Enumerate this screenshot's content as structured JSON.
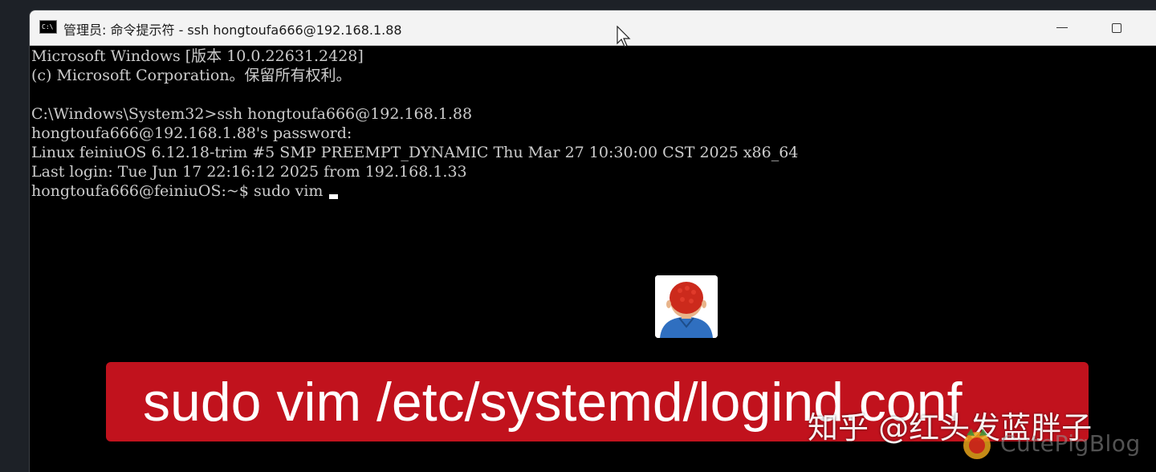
{
  "window": {
    "title": "管理员: 命令提示符 - ssh  hongtoufa666@192.168.1.88",
    "app_icon_label": "C:\\"
  },
  "console": {
    "lines": [
      "Microsoft Windows [版本 10.0.22631.2428]",
      "(c) Microsoft Corporation。保留所有权利。",
      "",
      "C:\\Windows\\System32>ssh hongtoufa666@192.168.1.88",
      "hongtoufa666@192.168.1.88's password:",
      "Linux feiniuOS 6.12.18-trim #5 SMP PREEMPT_DYNAMIC Thu Mar 27 10:30:00 CST 2025 x86_64",
      "Last login: Tue Jun 17 22:16:12 2025 from 192.168.1.33"
    ],
    "prompt": "hongtoufa666@feiniuOS:~$ sudo vim "
  },
  "overlay": {
    "banner_text": "sudo vim /etc/systemd/logind.conf",
    "watermark": "知乎 @红头发蓝胖子",
    "blog_name": "CutePigBlog"
  },
  "colors": {
    "banner": "#c1121d",
    "console_text": "#cccccc",
    "console_bg": "#000000"
  },
  "icons": {
    "app": "cmd-icon",
    "minimize": "minimize-icon",
    "maximize": "maximize-icon",
    "mouse": "mouse-pointer-icon",
    "avatar": "avatar-red-hair",
    "blog_logo": "cute-pig-logo"
  }
}
